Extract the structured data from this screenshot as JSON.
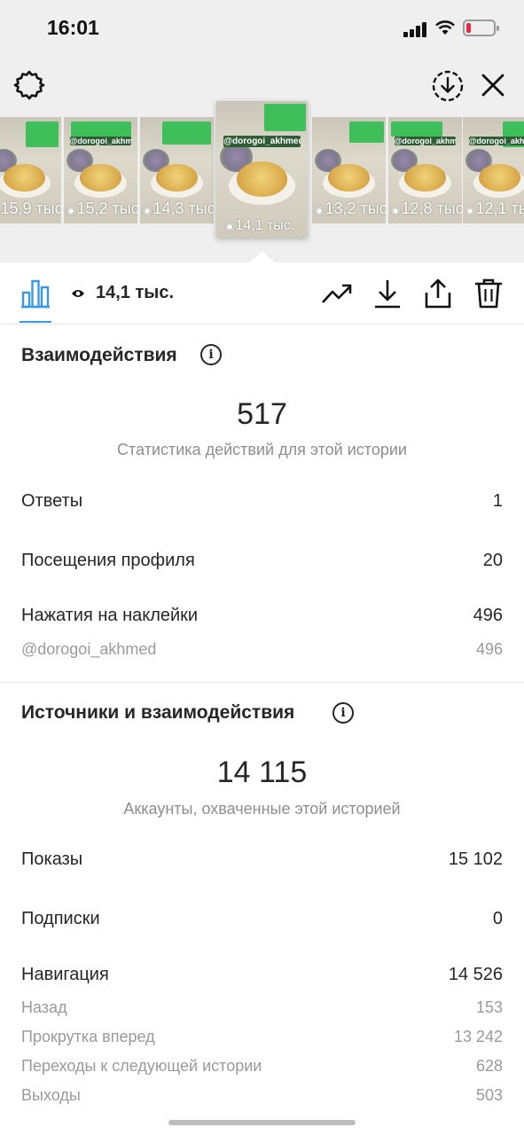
{
  "status_bar": {
    "time": "16:01"
  },
  "colors": {
    "accent": "#3897f0",
    "battery_low": "#e8283f",
    "sticker_green": "#3fbf5a"
  },
  "thumbnails": [
    {
      "views": "15,9 тыс.",
      "handle": ""
    },
    {
      "views": "15,2 тыс.",
      "handle": "@dorogoi_akhmed"
    },
    {
      "views": "14,3 тыс.",
      "handle": ""
    },
    {
      "views": "14,1 тыс.",
      "handle": "@dorogoi_akhmed",
      "active": true
    },
    {
      "views": "13,2 тыс.",
      "handle": ""
    },
    {
      "views": "12,8 тыс.",
      "handle": "@dorogoi_akhmed"
    },
    {
      "views": "12,1 тыс.",
      "handle": "@dorogoi_akhmed"
    }
  ],
  "toolbar": {
    "view_count": "14,1 тыс.",
    "icons": [
      "insights-icon",
      "eye-icon",
      "promote-trend-icon",
      "download-icon",
      "share-icon",
      "trash-icon"
    ]
  },
  "interactions": {
    "title": "Взаимодействия",
    "total": "517",
    "subtitle": "Статистика действий для этой истории",
    "rows": [
      {
        "label": "Ответы",
        "value": "1"
      },
      {
        "label": "Посещения профиля",
        "value": "20"
      },
      {
        "label": "Нажатия на наклейки",
        "value": "496"
      }
    ],
    "sticker": {
      "label": "@dorogoi_akhmed",
      "value": "496"
    }
  },
  "discovery": {
    "title": "Источники и взаимодействия",
    "total": "14 115",
    "subtitle": "Аккаунты, охваченные этой историей",
    "rows": [
      {
        "label": "Показы",
        "value": "15 102"
      },
      {
        "label": "Подписки",
        "value": "0"
      },
      {
        "label": "Навигация",
        "value": "14 526"
      }
    ],
    "navigation": [
      {
        "label": "Назад",
        "value": "153"
      },
      {
        "label": "Прокрутка вперед",
        "value": "13 242"
      },
      {
        "label": "Переходы к следующей истории",
        "value": "628"
      },
      {
        "label": "Выходы",
        "value": "503"
      }
    ]
  }
}
